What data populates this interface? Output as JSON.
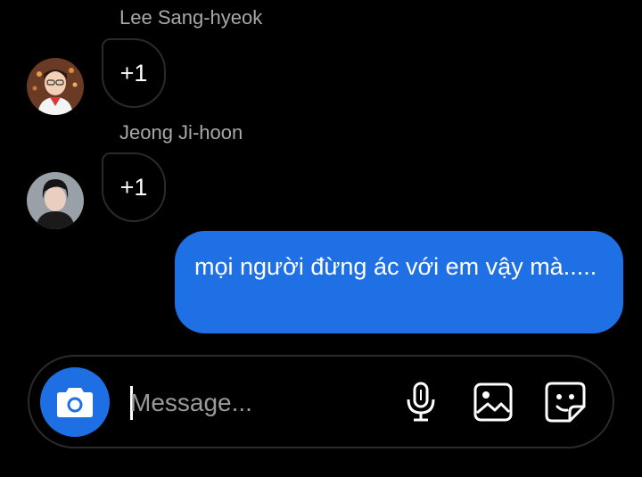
{
  "conversation": {
    "messages": [
      {
        "sender": "Lee Sang-hyeok",
        "reaction_count": "+1",
        "avatar": "avatar-photo-icon"
      },
      {
        "sender": "Jeong Ji-hoon",
        "reaction_count": "+1",
        "avatar": "avatar-photo-icon"
      }
    ],
    "my_message": "mọi người đừng ác với em vậy mà....."
  },
  "composer": {
    "placeholder": "Message...",
    "value": "",
    "icons": [
      "camera-icon",
      "microphone-icon",
      "gallery-icon",
      "sticker-icon"
    ]
  },
  "colors": {
    "background": "#000000",
    "accent": "#1f6fe5",
    "sender_name": "#a8a8a8",
    "bubble_border": "#2a2a2a"
  }
}
